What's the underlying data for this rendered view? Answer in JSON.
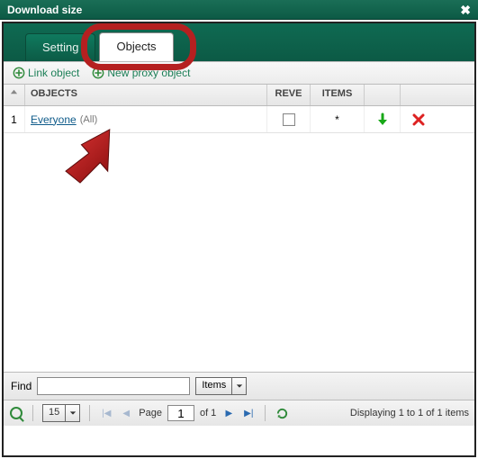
{
  "window": {
    "title": "Download size"
  },
  "tabs": {
    "setting": "Setting",
    "objects": "Objects",
    "active": "objects"
  },
  "toolbar": {
    "link_object": "Link object",
    "new_proxy": "New proxy object"
  },
  "grid": {
    "headers": {
      "objects": "OBJECTS",
      "reve": "REVE",
      "items": "ITEMS"
    },
    "rows": [
      {
        "idx": "1",
        "name": "Everyone",
        "suffix": "(All)",
        "reve_checked": false,
        "items": "*"
      }
    ]
  },
  "findbar": {
    "label": "Find",
    "value": "",
    "scope_selected": "Items"
  },
  "pager": {
    "page_size": "15",
    "page_label_pre": "Page",
    "page_current": "1",
    "page_label_post": "of 1",
    "status": "Displaying 1 to 1 of 1 items"
  }
}
